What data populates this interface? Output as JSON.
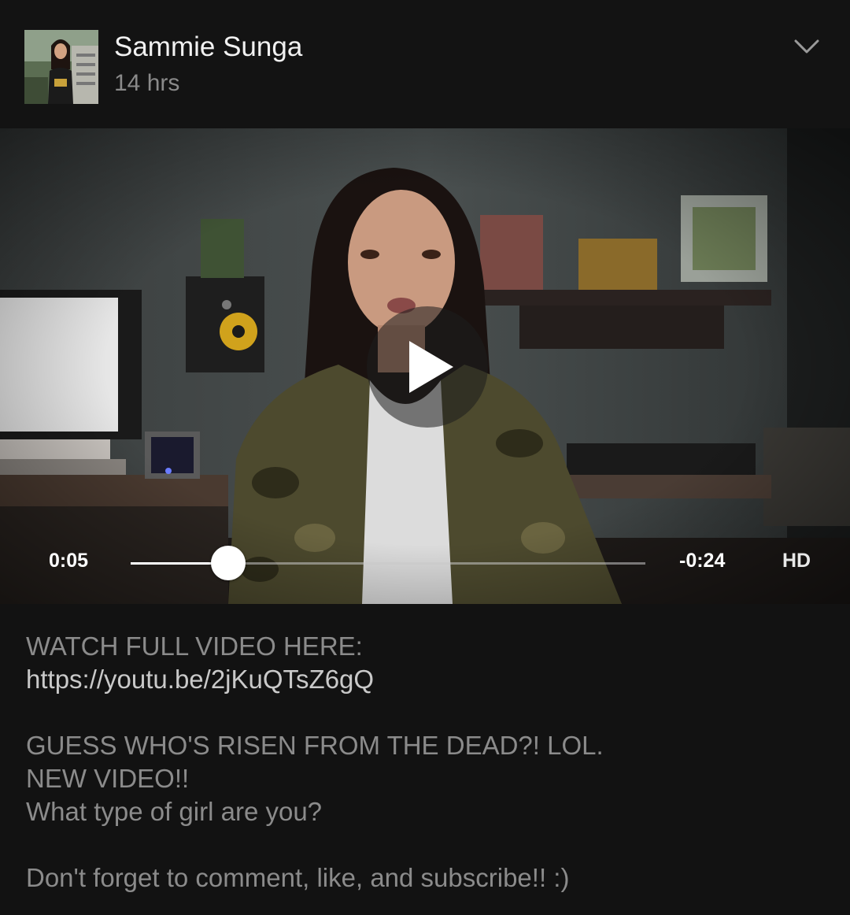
{
  "post": {
    "author": "Sammie Sunga",
    "timestamp": "14 hrs",
    "menu_icon": "chevron-down-icon"
  },
  "video": {
    "elapsed": "0:05",
    "remaining": "-0:24",
    "quality": "HD",
    "progress": 0.19,
    "play_icon": "play-icon"
  },
  "caption": {
    "line1": "WATCH FULL VIDEO HERE:",
    "link": "https://youtu.be/2jKuQTsZ6gQ",
    "line3": "GUESS WHO'S RISEN FROM THE DEAD?! LOL.",
    "line4": "NEW VIDEO!!",
    "line5": "What type of girl are you?",
    "line6": "Don't forget to comment, like, and subscribe!! :)"
  }
}
